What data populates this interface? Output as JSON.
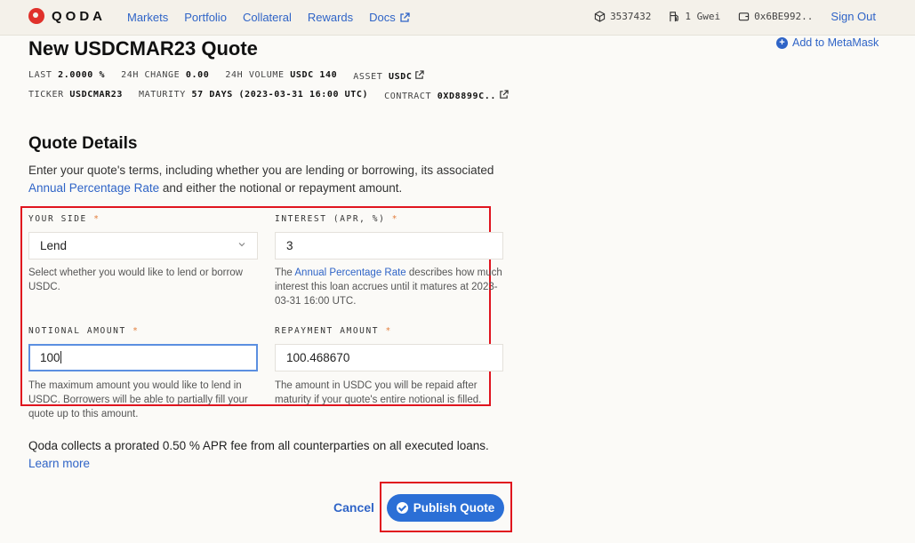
{
  "nav": {
    "brand": "QODA",
    "links": [
      "Markets",
      "Portfolio",
      "Collateral",
      "Rewards",
      "Docs"
    ],
    "block": "3537432",
    "gas": "1 Gwei",
    "wallet": "0x6BE992..",
    "signout": "Sign Out"
  },
  "header": {
    "title": "New USDCMAR23 Quote",
    "metamask": "Add to MetaMask",
    "row1": [
      {
        "label": "LAST",
        "value": "2.0000 %"
      },
      {
        "label": "24H CHANGE",
        "value": "0.00"
      },
      {
        "label": "24H VOLUME",
        "value": "USDC 140"
      },
      {
        "label": "ASSET",
        "value": "USDC"
      }
    ],
    "row2": [
      {
        "label": "TICKER",
        "value": "USDCMAR23"
      },
      {
        "label": "MATURITY",
        "value": "57 DAYS (2023-03-31 16:00 UTC)"
      },
      {
        "label": "CONTRACT",
        "value": "0XD8899C.."
      }
    ]
  },
  "details": {
    "title": "Quote Details",
    "intro_before": "Enter your quote's terms, including whether you are lending or borrowing, its associated",
    "intro_link": "Annual Percentage Rate",
    "intro_after": "and either the notional or repayment amount."
  },
  "form": {
    "side_label": "YOUR SIDE",
    "side_value": "Lend",
    "side_help": "Select whether you would like to lend or borrow USDC.",
    "interest_label": "INTEREST (APR, %)",
    "interest_value": "3",
    "interest_help_before": "The",
    "interest_help_link": "Annual Percentage Rate",
    "interest_help_after": "describes how much interest this loan accrues until it matures at 2023-03-31 16:00 UTC.",
    "notional_label": "NOTIONAL AMOUNT",
    "notional_value": "100",
    "notional_help": "The maximum amount you would like to lend in USDC. Borrowers will be able to partially fill your quote up to this amount.",
    "repayment_label": "REPAYMENT AMOUNT",
    "repayment_value": "100.468670",
    "repayment_help": "The amount in USDC you will be repaid after maturity if your quote's entire notional is filled.",
    "required_mark": "*"
  },
  "fee": {
    "text": "Qoda collects a prorated 0.50 % APR fee from all counterparties on all executed loans.",
    "link": "Learn more"
  },
  "actions": {
    "cancel": "Cancel",
    "publish": "Publish Quote"
  },
  "colors": {
    "accent": "#2f64c7",
    "button": "#2b6fd6",
    "highlight": "#e0141e",
    "required": "#e37d3b"
  }
}
